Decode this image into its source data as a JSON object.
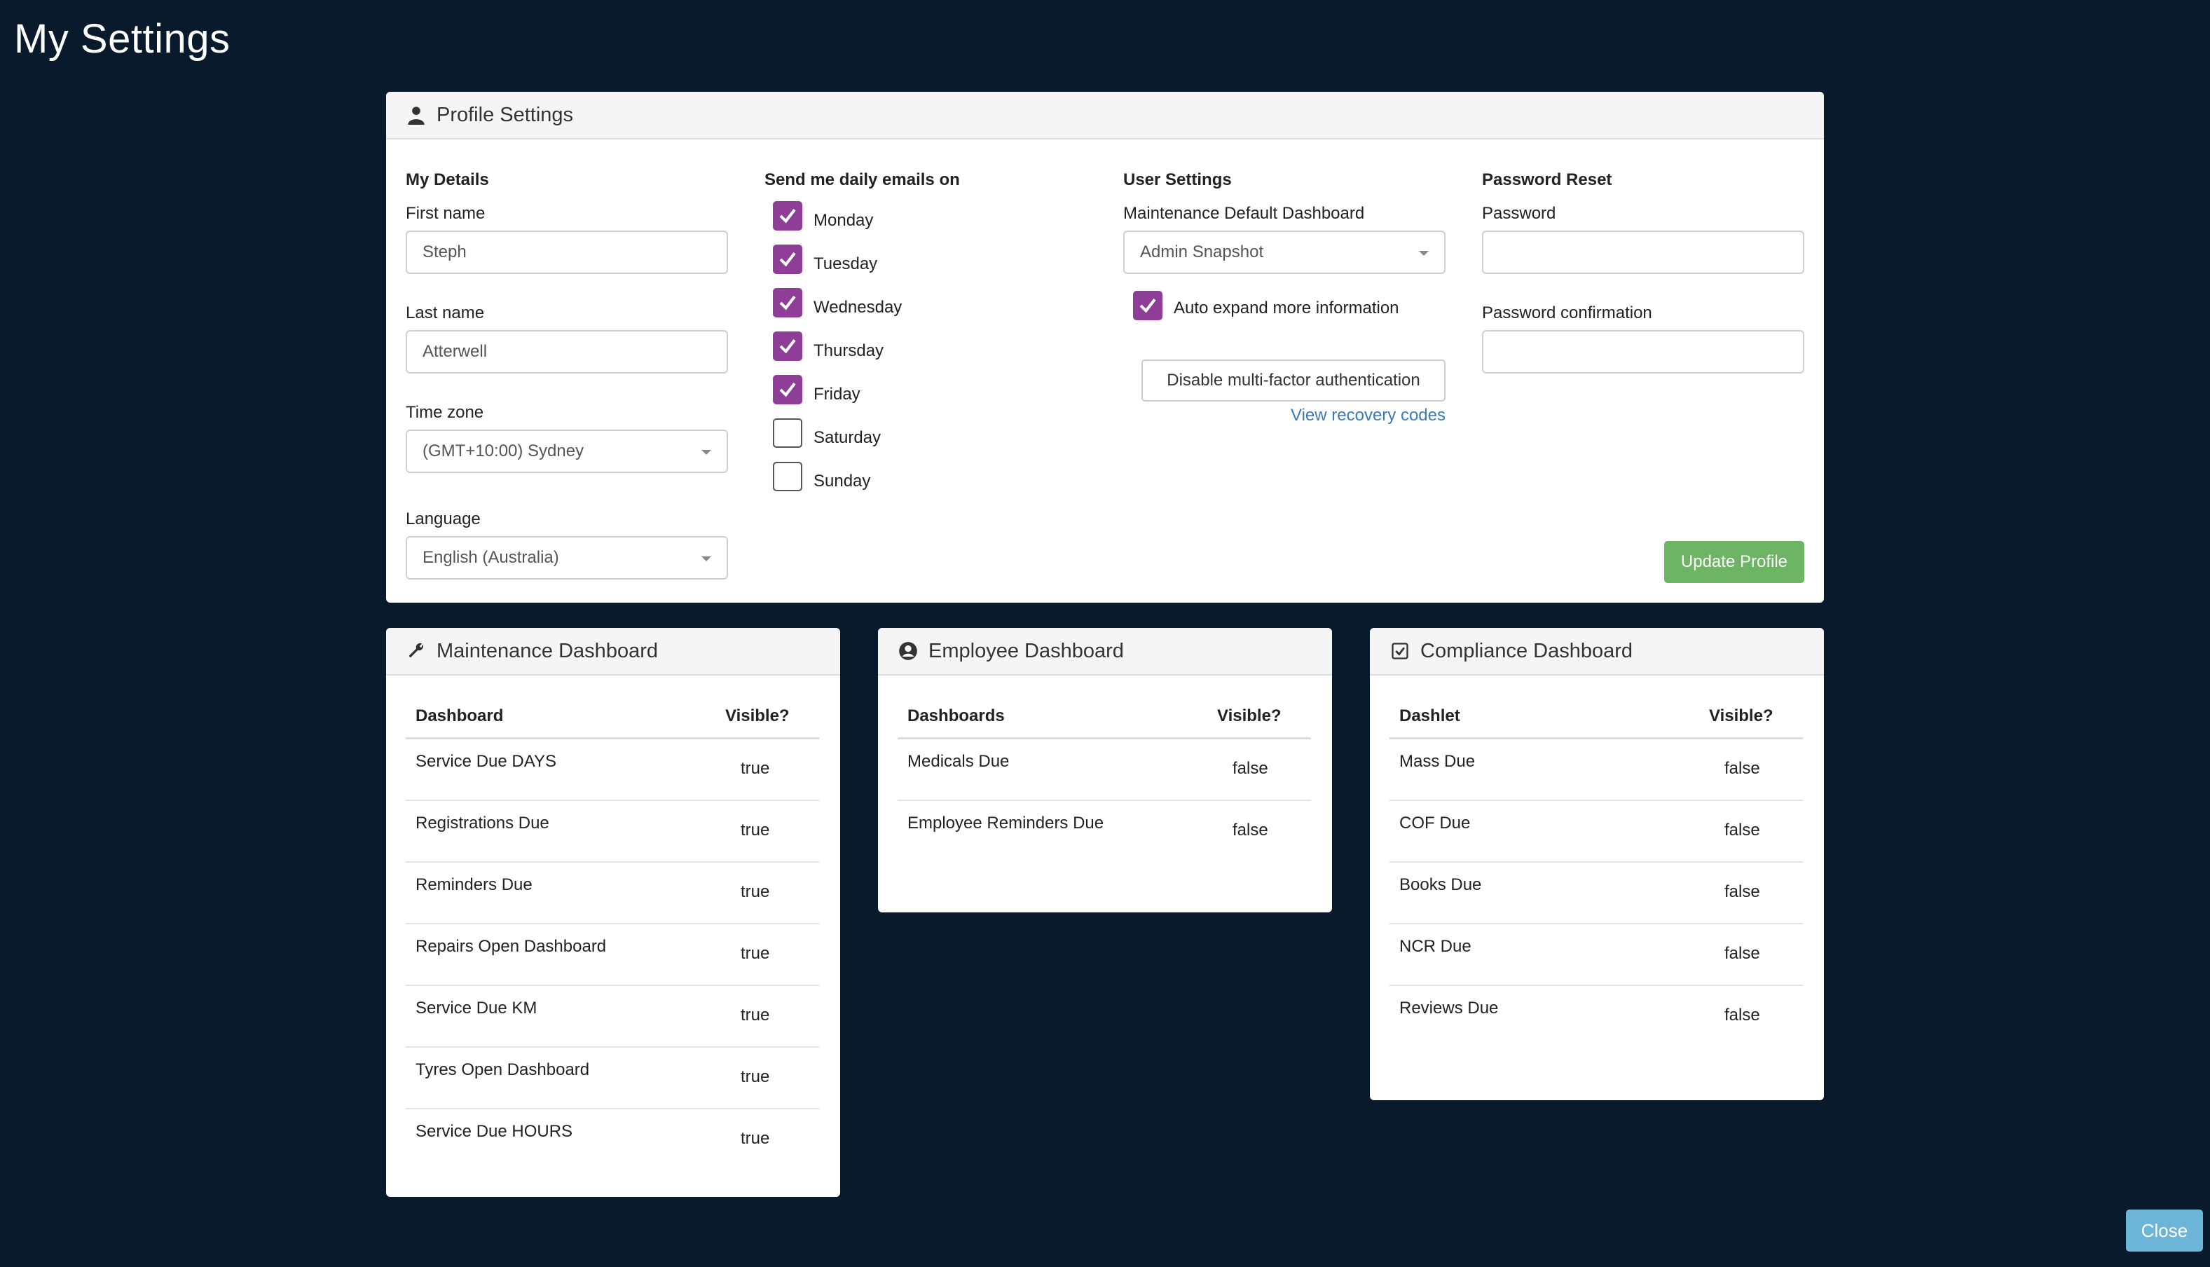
{
  "page": {
    "title": "My Settings"
  },
  "profile": {
    "header": "Profile Settings",
    "details": {
      "heading": "My Details",
      "first_name_label": "First name",
      "first_name_value": "Steph",
      "last_name_label": "Last name",
      "last_name_value": "Atterwell",
      "timezone_label": "Time zone",
      "timezone_value": "(GMT+10:00) Sydney",
      "language_label": "Language",
      "language_value": "English (Australia)"
    },
    "emails": {
      "heading": "Send me daily emails on",
      "days": [
        {
          "label": "Monday",
          "checked": true
        },
        {
          "label": "Tuesday",
          "checked": true
        },
        {
          "label": "Wednesday",
          "checked": true
        },
        {
          "label": "Thursday",
          "checked": true
        },
        {
          "label": "Friday",
          "checked": true
        },
        {
          "label": "Saturday",
          "checked": false
        },
        {
          "label": "Sunday",
          "checked": false
        }
      ]
    },
    "user_settings": {
      "heading": "User Settings",
      "default_dashboard_label": "Maintenance Default Dashboard",
      "default_dashboard_value": "Admin Snapshot",
      "auto_expand_label": "Auto expand more information",
      "auto_expand_checked": true,
      "mfa_button": "Disable multi-factor authentication",
      "recovery_link": "View recovery codes"
    },
    "password": {
      "heading": "Password Reset",
      "password_label": "Password",
      "confirm_label": "Password confirmation"
    },
    "update_button": "Update Profile"
  },
  "maintenance": {
    "header": "Maintenance Dashboard",
    "col_name": "Dashboard",
    "col_visible": "Visible?",
    "rows": [
      {
        "name": "Service Due DAYS",
        "visible": "true"
      },
      {
        "name": "Registrations Due",
        "visible": "true"
      },
      {
        "name": "Reminders Due",
        "visible": "true"
      },
      {
        "name": "Repairs Open Dashboard",
        "visible": "true"
      },
      {
        "name": "Service Due KM",
        "visible": "true"
      },
      {
        "name": "Tyres Open Dashboard",
        "visible": "true"
      },
      {
        "name": "Service Due HOURS",
        "visible": "true"
      }
    ]
  },
  "employee": {
    "header": "Employee Dashboard",
    "col_name": "Dashboards",
    "col_visible": "Visible?",
    "rows": [
      {
        "name": "Medicals Due",
        "visible": "false"
      },
      {
        "name": "Employee Reminders Due",
        "visible": "false"
      }
    ]
  },
  "compliance": {
    "header": "Compliance Dashboard",
    "col_name": "Dashlet",
    "col_visible": "Visible?",
    "rows": [
      {
        "name": "Mass Due",
        "visible": "false"
      },
      {
        "name": "COF Due",
        "visible": "false"
      },
      {
        "name": "Books Due",
        "visible": "false"
      },
      {
        "name": "NCR Due",
        "visible": "false"
      },
      {
        "name": "Reviews Due",
        "visible": "false"
      }
    ]
  },
  "footer": {
    "close_button": "Close"
  },
  "colors": {
    "background": "#091a2c",
    "accent_checkbox": "#8f3e97",
    "update_green": "#6db565",
    "close_blue": "#6cb5d9",
    "link_blue": "#3a7bbd"
  },
  "icons": {
    "profile": "user-icon",
    "maintenance": "wrench-icon",
    "employee": "user-circle-icon",
    "compliance": "check-square-icon",
    "checkbox": "checkmark-icon"
  }
}
